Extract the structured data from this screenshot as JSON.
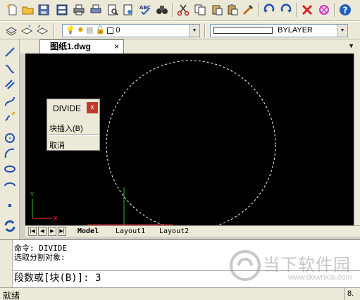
{
  "toolbar1": {
    "icons": [
      "new-file-icon",
      "open-file-icon",
      "save-icon",
      "save-as-icon",
      "print-icon",
      "plot-icon",
      "print-preview-icon",
      "page-setup-icon",
      "spell-check-icon",
      "find-icon",
      "cut-icon",
      "copy-icon",
      "copy-clip-icon",
      "paste-icon",
      "match-properties-icon",
      "undo-icon",
      "redo-icon",
      "erase-icon",
      "purge-icon",
      "help-icon"
    ]
  },
  "toolbar2": {
    "layer_value": "0",
    "linetype_value": "BYLAYER"
  },
  "document_tab": {
    "title": "图纸1.dwg",
    "close": "×"
  },
  "popup": {
    "title": "DIVIDE",
    "close": "x",
    "option_block": "块插入(B)",
    "option_cancel": "取消"
  },
  "layout_tabs": [
    "Model",
    "Layout1",
    "Layout2"
  ],
  "command": {
    "line1": "命令:  DIVIDE",
    "line2": "选取分割对象:",
    "prompt": "段数或[块(B)]: 3"
  },
  "status": {
    "text": "就绪",
    "coord": "8."
  },
  "watermark": {
    "title": "当下软件园",
    "url": "www.downxia.com"
  },
  "colors": {
    "canvas": "#000000",
    "close_red": "#c0392b",
    "ucs_x": "#ff3030",
    "ucs_y": "#30c030"
  }
}
